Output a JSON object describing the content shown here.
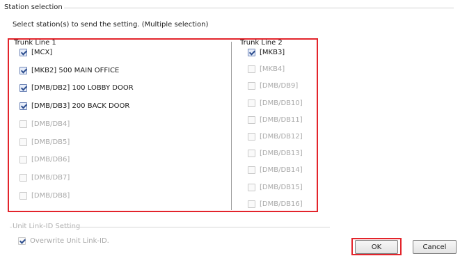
{
  "group": {
    "title": "Station selection"
  },
  "instruction": "Select station(s) to send the setting. (Multiple selection)",
  "trunk_line_1": {
    "title": "Trunk Line 1",
    "items": [
      {
        "label": "[MCX]",
        "checked": true,
        "enabled": true
      },
      {
        "label": "[MKB2] 500 MAIN OFFICE",
        "checked": true,
        "enabled": true
      },
      {
        "label": "[DMB/DB2] 100 LOBBY DOOR",
        "checked": true,
        "enabled": true
      },
      {
        "label": "[DMB/DB3] 200 BACK DOOR",
        "checked": true,
        "enabled": true
      },
      {
        "label": "[DMB/DB4]",
        "checked": false,
        "enabled": false
      },
      {
        "label": "[DMB/DB5]",
        "checked": false,
        "enabled": false
      },
      {
        "label": "[DMB/DB6]",
        "checked": false,
        "enabled": false
      },
      {
        "label": "[DMB/DB7]",
        "checked": false,
        "enabled": false
      },
      {
        "label": "[DMB/DB8]",
        "checked": false,
        "enabled": false
      }
    ]
  },
  "trunk_line_2": {
    "title": "Trunk Line 2",
    "items": [
      {
        "label": "[MKB3]",
        "checked": true,
        "enabled": true
      },
      {
        "label": "[MKB4]",
        "checked": false,
        "enabled": false
      },
      {
        "label": "[DMB/DB9]",
        "checked": false,
        "enabled": false
      },
      {
        "label": "[DMB/DB10]",
        "checked": false,
        "enabled": false
      },
      {
        "label": "[DMB/DB11]",
        "checked": false,
        "enabled": false
      },
      {
        "label": "[DMB/DB12]",
        "checked": false,
        "enabled": false
      },
      {
        "label": "[DMB/DB13]",
        "checked": false,
        "enabled": false
      },
      {
        "label": "[DMB/DB14]",
        "checked": false,
        "enabled": false
      },
      {
        "label": "[DMB/DB15]",
        "checked": false,
        "enabled": false
      },
      {
        "label": "[DMB/DB16]",
        "checked": false,
        "enabled": false
      }
    ]
  },
  "unit_link": {
    "title": "Unit Link-ID Setting",
    "overwrite_label": "Overwrite Unit Link-ID.",
    "overwrite_checked": true,
    "enabled": false
  },
  "buttons": {
    "ok": "OK",
    "cancel": "Cancel"
  },
  "colors": {
    "highlight": "#e3242b",
    "disabled_text": "#a8a8a8"
  }
}
